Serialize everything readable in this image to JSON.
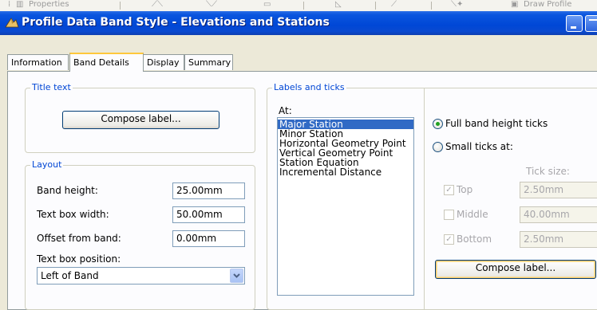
{
  "toolbar": {
    "partial_label": "Properties",
    "right_label": "Draw Profile"
  },
  "window": {
    "title": "Profile Data Band Style - Elevations and Stations"
  },
  "tabs": [
    {
      "label": "Information",
      "active": false
    },
    {
      "label": "Band Details",
      "active": true
    },
    {
      "label": "Display",
      "active": false
    },
    {
      "label": "Summary",
      "active": false
    }
  ],
  "title_text": {
    "legend": "Title text",
    "compose_button": "Compose label..."
  },
  "layout": {
    "legend": "Layout",
    "band_height_label": "Band height:",
    "band_height_value": "25.00mm",
    "text_box_width_label": "Text box width:",
    "text_box_width_value": "50.00mm",
    "offset_label": "Offset from band:",
    "offset_value": "0.00mm",
    "text_box_position_label": "Text box position:",
    "text_box_position_value": "Left of Band"
  },
  "labels_ticks": {
    "legend": "Labels and ticks",
    "at_label": "At:",
    "items": [
      {
        "label": "Major Station",
        "selected": true
      },
      {
        "label": "Minor Station",
        "selected": false
      },
      {
        "label": "Horizontal Geometry Point",
        "selected": false
      },
      {
        "label": "Vertical Geometry Point",
        "selected": false
      },
      {
        "label": "Station Equation",
        "selected": false
      },
      {
        "label": "Incremental Distance",
        "selected": false
      }
    ],
    "full_band_label": "Full band height ticks",
    "full_band_selected": true,
    "small_ticks_label": "Small ticks at:",
    "tick_size_label": "Tick size:",
    "top_label": "Top",
    "top_checked": true,
    "top_value": "2.50mm",
    "middle_label": "Middle",
    "middle_checked": false,
    "middle_value": "40.00mm",
    "bottom_label": "Bottom",
    "bottom_checked": true,
    "bottom_value": "2.50mm",
    "compose_button": "Compose label..."
  }
}
